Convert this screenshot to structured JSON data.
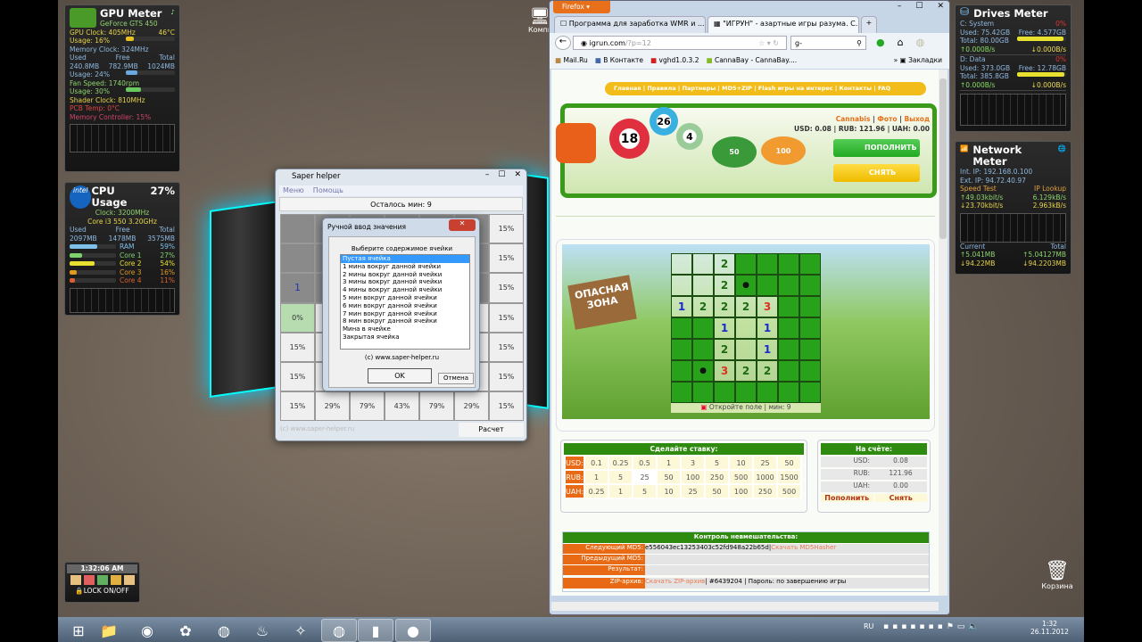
{
  "gpu_meter": {
    "title": "GPU Meter",
    "model": "GeForce GTS 450",
    "clock": "GPU Clock: 405MHz",
    "temp": "46°C",
    "usage": "Usage: 16%",
    "usage_pct": 16,
    "mem_clock": "Memory Clock: 324MHz",
    "mem_headers": [
      "Used",
      "Free",
      "Total"
    ],
    "mem_values": [
      "240.8MB",
      "782.9MB",
      "1024MB"
    ],
    "mem_usage": "Usage: 24%",
    "mem_usage_pct": 24,
    "fan": "Fan Speed: 1740rpm",
    "fan_usage": "Usage: 30%",
    "fan_usage_pct": 30,
    "shader": "Shader Clock: 810MHz",
    "pcb": "PCB Temp: 0°C",
    "mem_ctrl": "Memory Controller: 15%"
  },
  "cpu_meter": {
    "title": "CPU Usage",
    "total": "27%",
    "logo": "intel",
    "clock": "Clock: 3200MHz",
    "model": "Core i3 550 3.20GHz",
    "headers": [
      "Used",
      "Free",
      "Total"
    ],
    "values": [
      "2097MB",
      "1478MB",
      "3575MB"
    ],
    "bars": [
      {
        "label": "RAM",
        "value": "59%",
        "pct": 59,
        "color": "#7ec0ea"
      },
      {
        "label": "Core 1",
        "value": "27%",
        "pct": 27,
        "color": "#7ed26e"
      },
      {
        "label": "Core 2",
        "value": "54%",
        "pct": 54,
        "color": "#e8e030"
      },
      {
        "label": "Core 3",
        "value": "16%",
        "pct": 16,
        "color": "#e09a20"
      },
      {
        "label": "Core 4",
        "value": "11%",
        "pct": 11,
        "color": "#d86030"
      }
    ]
  },
  "drives_meter": {
    "title": "Drives Meter",
    "drives": [
      {
        "name": "C: System",
        "pct": "0%",
        "used": "Used: 75.42GB",
        "free": "Free: 4.577GB",
        "total": "Total: 80.00GB",
        "fill": 94,
        "up": "0.000B/s",
        "down": "0.000B/s"
      },
      {
        "name": "D: Data",
        "pct": "0%",
        "used": "Used: 373.0GB",
        "free": "Free: 12.78GB",
        "total": "Total: 385.8GB",
        "fill": 97,
        "up": "0.000B/s",
        "down": "0.000B/s"
      }
    ]
  },
  "network_meter": {
    "title": "Network Meter",
    "int_ip": "Int. IP: 192.168.0.100",
    "ext_ip": "Ext. IP: 94.72.40.97",
    "speed_test": "Speed Test",
    "ip_lookup": "IP Lookup",
    "up1": "49.03kbit/s",
    "up2": "6.129kB/s",
    "down1": "23.70kbit/s",
    "down2": "2.963kB/s",
    "current": "Current",
    "total": "Total",
    "cur_up": "5.041MB",
    "cur_down": "94.22MB",
    "tot_up": "5.04127MB",
    "tot_down": "94.2203MB"
  },
  "clock_gadget": {
    "time": "1:32:06 AM",
    "lock": "LOCK ON/OFF"
  },
  "desktop": {
    "computer_label": "Компь",
    "recycle_label": "Корзина"
  },
  "saper_helper": {
    "title": "Saper helper",
    "menu": [
      "Меню",
      "Помощь"
    ],
    "status": "Осталось мин: 9",
    "footer": "(c) www.saper-helper.ru",
    "calc_button": "Расчет",
    "grid": [
      [
        "",
        "",
        "",
        "",
        "",
        "",
        "15%"
      ],
      [
        "",
        "",
        "",
        "",
        "",
        "",
        "15%"
      ],
      [
        "1",
        "",
        "",
        "",
        "",
        "",
        "15%"
      ],
      [
        "0%",
        "",
        "",
        "",
        "",
        "",
        "15%"
      ],
      [
        "15%",
        "",
        "",
        "",
        "",
        "",
        "15%"
      ],
      [
        "15%",
        "",
        "",
        "",
        "",
        "",
        "15%"
      ],
      [
        "15%",
        "29%",
        "79%",
        "43%",
        "79%",
        "29%",
        "15%"
      ]
    ]
  },
  "dialog": {
    "title": "Ручной ввод значения",
    "group": "Выберите содержимое ячейки",
    "options": [
      "Пустая ячейка",
      "1 мина вокруг данной ячейки",
      "2 мины вокруг данной ячейки",
      "3 мины вокруг данной ячейки",
      "4 мины вокруг данной ячейки",
      "5 мин вокруг данной ячейки",
      "6 мин вокруг данной ячейки",
      "7 мин вокруг данной ячейки",
      "8 мин вокруг данной ячейки",
      "Мина в ячейке",
      "Закрытая ячейка"
    ],
    "selected": 0,
    "copyright": "(c) www.saper-helper.ru",
    "ok": "OK",
    "cancel": "Отмена"
  },
  "firefox": {
    "menu_button": "Firefox",
    "tabs": [
      {
        "label": "Программа для заработка WMR и ...",
        "active": false
      },
      {
        "label": "\"ИГРУН\" - азартные игры разума. С...",
        "active": true
      }
    ],
    "url_host": "igrun.com",
    "url_path": "/?p=12",
    "search_value": "-",
    "bookmarks": [
      "Mail.Ru",
      "В Контакте",
      "vghd1.0.3.2",
      "CannaBay - CannaBay...."
    ],
    "bookmarks_menu": "Закладки",
    "site": {
      "nav": [
        "Главная",
        "Правила",
        "Партнеры",
        "MD5+ZIP",
        "Flash игры на интерес",
        "Контакты",
        "FAQ"
      ],
      "user_links": [
        "Cannabis",
        "Фото",
        "Выход"
      ],
      "balance_line": "USD: 0.08 | RUB: 121.96 | UAH: 0.00",
      "deposit_button": "ПОПОЛНИТЬ",
      "withdraw_button": "СНЯТЬ",
      "sign_text": "ОПАСНАЯ ЗОНА",
      "board": [
        "..2GGGG",
        "..2MGGG",
        "12223GG",
        "GG1.1GG",
        "GG2.1GG",
        "GM322GG",
        "GGGGGGG"
      ],
      "board_status": "Откройте поле | мин: 9",
      "bet_title": "Сделайте ставку:",
      "bets": [
        {
          "cur": "USD",
          "values": [
            "0.1",
            "0.25",
            "0.5",
            "1",
            "3",
            "5",
            "10",
            "25",
            "50"
          ]
        },
        {
          "cur": "RUB",
          "values": [
            "1",
            "5",
            "25",
            "50",
            "100",
            "250",
            "500",
            "1000",
            "1500"
          ]
        },
        {
          "cur": "UAH",
          "values": [
            "0.25",
            "1",
            "5",
            "10",
            "25",
            "50",
            "100",
            "250",
            "500"
          ]
        }
      ],
      "selected_bet": "25",
      "account_title": "На счёте:",
      "account": [
        {
          "cur": "USD:",
          "val": "0.08"
        },
        {
          "cur": "RUB:",
          "val": "121.96"
        },
        {
          "cur": "UAH:",
          "val": "0.00"
        }
      ],
      "acc_deposit": "Пополнить",
      "acc_withdraw": "Снять",
      "control_title": "Контроль невмешательства:",
      "control_rows": [
        {
          "label": "Следующий MD5:",
          "value": "e556043ec13253403c52fd948a22b65d",
          "sep": " | ",
          "link": "Скачать MD5Hasher"
        },
        {
          "label": "Предыдущий MD5:",
          "value": "",
          "sep": "",
          "link": ""
        },
        {
          "label": "Результат:",
          "value": "",
          "sep": "",
          "link": ""
        }
      ],
      "zip": {
        "label": "ZIP-архив:",
        "link": "Скачать ZIP-архив",
        "value": " | #6439204 | Пароль: по завершению игры"
      }
    }
  },
  "taskbar": {
    "lang": "RU",
    "time": "1:32",
    "date": "26.11.2012",
    "apps": [
      "start",
      "explorer",
      "webcam",
      "picasa",
      "firefox",
      "steam",
      "puzzle",
      "firefox-active",
      "saper-helper",
      "bomb-app"
    ]
  },
  "colors": {
    "site_green": "#2f8a10",
    "site_orange": "#e96a14",
    "site_yellow": "#f4c000"
  }
}
